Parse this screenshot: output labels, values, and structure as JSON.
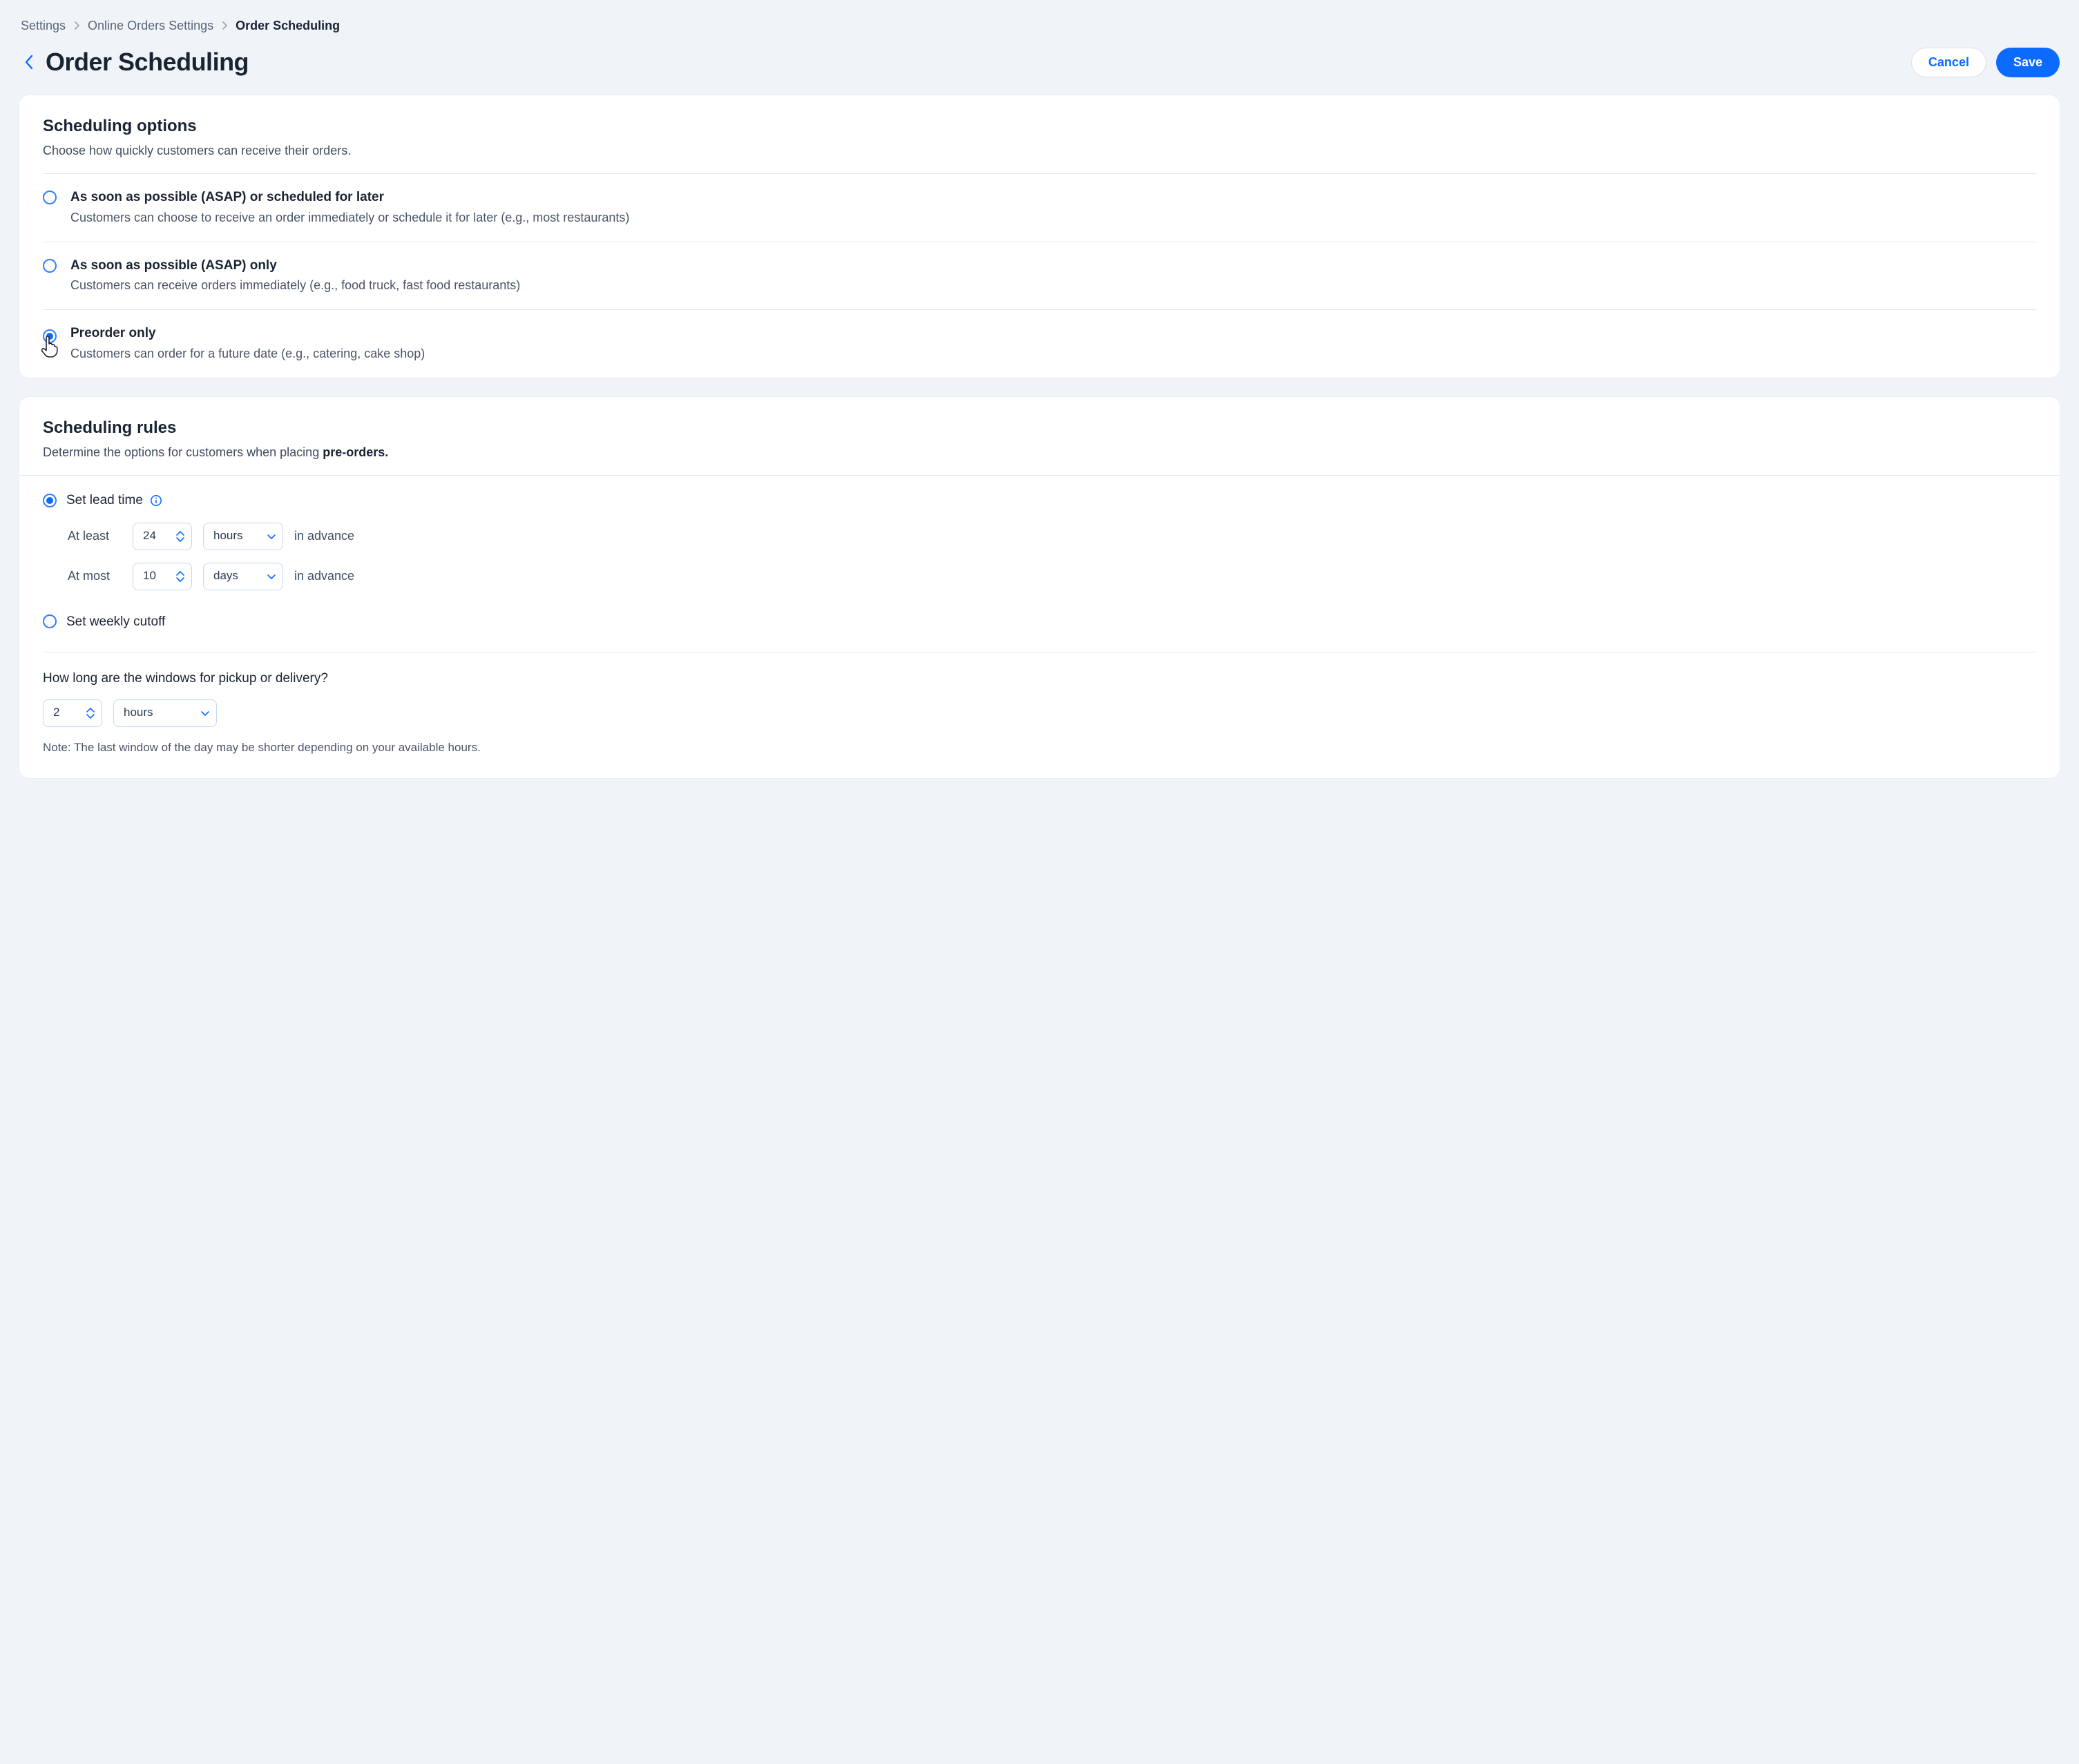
{
  "breadcrumb": {
    "items": [
      {
        "label": "Settings"
      },
      {
        "label": "Online Orders Settings"
      },
      {
        "label": "Order Scheduling"
      }
    ]
  },
  "header": {
    "title": "Order Scheduling",
    "cancel": "Cancel",
    "save": "Save"
  },
  "scheduling_options": {
    "title": "Scheduling options",
    "subtitle": "Choose how quickly customers can receive their orders.",
    "items": [
      {
        "title": "As soon as possible (ASAP) or scheduled for later",
        "desc": "Customers can choose to receive an order immediately or schedule it for later (e.g., most restaurants)",
        "selected": false
      },
      {
        "title": "As soon as possible (ASAP)  only",
        "desc": "Customers can receive orders immediately (e.g., food truck, fast food restaurants)",
        "selected": false
      },
      {
        "title": "Preorder only",
        "desc": "Customers can order for a future date (e.g., catering, cake shop)",
        "selected": true
      }
    ]
  },
  "scheduling_rules": {
    "title": "Scheduling rules",
    "subtitle_prefix": "Determine the options for customers when placing ",
    "subtitle_strong": "pre-orders.",
    "mode": {
      "lead_time": {
        "label": "Set lead time",
        "selected": true
      },
      "weekly_cutoff": {
        "label": "Set weekly cutoff",
        "selected": false
      }
    },
    "lead_time": {
      "at_least_label": "At least",
      "at_least_value": "24",
      "at_least_unit": "hours",
      "at_most_label": "At most",
      "at_most_value": "10",
      "at_most_unit": "days",
      "trail": "in advance"
    },
    "window": {
      "question": "How long are the windows for pickup or delivery?",
      "value": "2",
      "unit": "hours",
      "note": "Note: The last window of the day may be shorter depending on your available hours."
    }
  }
}
